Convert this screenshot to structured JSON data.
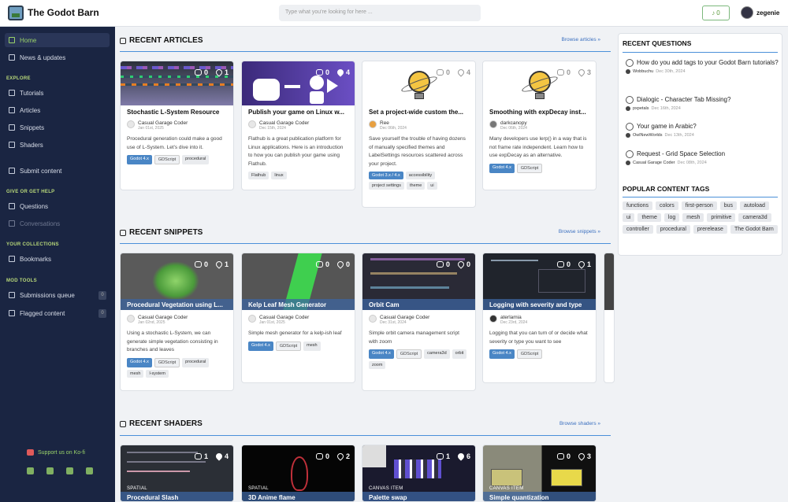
{
  "header": {
    "brand": "The Godot Barn",
    "search_placeholder": "Type what you're looking for here ...",
    "notif_count": "0",
    "username": "zegenie"
  },
  "sidebar": {
    "home": "Home",
    "news": "News & updates",
    "explore_head": "EXPLORE",
    "tutorials": "Tutorials",
    "articles": "Articles",
    "snippets": "Snippets",
    "shaders": "Shaders",
    "submit": "Submit content",
    "help_head": "GIVE OR GET HELP",
    "questions": "Questions",
    "conversations": "Conversations",
    "coll_head": "YOUR COLLECTIONS",
    "bookmarks": "Bookmarks",
    "mod_head": "MOD TOOLS",
    "subq": "Submissions queue",
    "subq_count": "0",
    "flagged": "Flagged content",
    "flagged_count": "0",
    "kofi": "Support us on Ko-fi"
  },
  "sections": {
    "articles": {
      "title": "RECENT ARTICLES",
      "link": "Browse articles"
    },
    "snippets": {
      "title": "RECENT SNIPPETS",
      "link": "Browse snippets"
    },
    "shaders": {
      "title": "RECENT SHADERS",
      "link": "Browse shaders"
    }
  },
  "articles": [
    {
      "title": "Stochastic L-System Resource",
      "author": "Casual Garage Coder",
      "date": "Jan 01st, 2025",
      "desc": "Procedural generation could make a good use of L-System. Let's dive into it.",
      "comments": "0",
      "likes": "1",
      "tags": [
        "Godot 4.x",
        "GDScript",
        "procedural"
      ]
    },
    {
      "title": "Publish your game on Linux w...",
      "author": "Casual Garage Coder",
      "date": "Dec 15th, 2024",
      "desc": "Flathub is a great publication platform for Linux applications. Here is an introduction to how you can publish your game using Flathub.",
      "comments": "0",
      "likes": "4",
      "tags": [
        "Flathub",
        "linux"
      ]
    },
    {
      "title": "Set a project-wide custom the...",
      "author": "Ree",
      "date": "Dec 06th, 2024",
      "desc": "Save yourself the trouble of having dozens of manually specified themes and LabelSettings resources scattered across your project.",
      "comments": "0",
      "likes": "4",
      "tags": [
        "Godot 3.x / 4.x",
        "accessibility",
        "project settings",
        "theme",
        "ui"
      ]
    },
    {
      "title": "Smoothing with expDecay inst...",
      "author": "darkcanopy",
      "date": "Dec 06th, 2024",
      "desc": "Many developers use lerp() in a way that is not frame rate independent. Learn how to use expDecay as an alternative.",
      "comments": "0",
      "likes": "3",
      "tags": [
        "Godot 4.x",
        "GDScript"
      ]
    }
  ],
  "snippets": [
    {
      "title": "Procedural Vegetation using L...",
      "author": "Casual Garage Coder",
      "date": "Jan 02nd, 2025",
      "desc": "Using a stochastic L-System, we can generate simple vegetation consisting in branches and leaves",
      "comments": "0",
      "likes": "1",
      "tags": [
        "Godot 4.x",
        "GDScript",
        "procedural",
        "mesh",
        "l-system"
      ]
    },
    {
      "title": "Kelp Leaf Mesh Generator",
      "author": "Casual Garage Coder",
      "date": "Jan 01st, 2025",
      "desc": "Simple mesh generator for a kelp-ish leaf",
      "comments": "0",
      "likes": "0",
      "tags": [
        "Godot 4.x",
        "GDScript",
        "mesh"
      ]
    },
    {
      "title": "Orbit Cam",
      "author": "Casual Garage Coder",
      "date": "Dec 31st, 2024",
      "desc": "Simple orbit camera management script with zoom",
      "comments": "0",
      "likes": "0",
      "tags": [
        "Godot 4.x",
        "GDScript",
        "camera3d",
        "orbit",
        "zoom"
      ]
    },
    {
      "title": "Logging with severity and type",
      "author": "aterlamia",
      "date": "Dec 23rd, 2024",
      "desc": "Logging that you can turn of or decide what severity or type you want to see",
      "comments": "0",
      "likes": "1",
      "tags": [
        "Godot 4.x",
        "GDScript"
      ]
    }
  ],
  "shaders": [
    {
      "title": "Procedural Slash",
      "type": "SPATIAL",
      "comments": "1",
      "likes": "4"
    },
    {
      "title": "3D Anime flame",
      "type": "SPATIAL",
      "comments": "0",
      "likes": "2"
    },
    {
      "title": "Palette swap",
      "type": "CANVAS ITEM",
      "comments": "1",
      "likes": "6"
    },
    {
      "title": "Simple quantization",
      "type": "CANVAS ITEM",
      "comments": "0",
      "likes": "3"
    }
  ],
  "right": {
    "questions_title": "RECENT QUESTIONS",
    "questions": [
      {
        "title": "How do you add tags to your Godot Barn tutorials?",
        "author": "Wobbuchu",
        "date": "Dec 30th, 2024"
      },
      {
        "title": "Dialogic - Character Tab Missing?",
        "author": "pxpetals",
        "date": "Dec 16th, 2024"
      },
      {
        "title": "Your game in Arabic?",
        "author": "OwlNewWorlds",
        "date": "Dec 13th, 2024"
      },
      {
        "title": "Request - Grid Space Selection",
        "author": "Casual Garage Coder",
        "date": "Dec 08th, 2024"
      }
    ],
    "tags_title": "POPULAR CONTENT TAGS",
    "tags": [
      "functions",
      "colors",
      "first-person",
      "bus",
      "autoload",
      "ui",
      "theme",
      "log",
      "mesh",
      "primitive",
      "camera3d",
      "controller",
      "procedural",
      "prerelease",
      "The Godot Barn"
    ]
  }
}
